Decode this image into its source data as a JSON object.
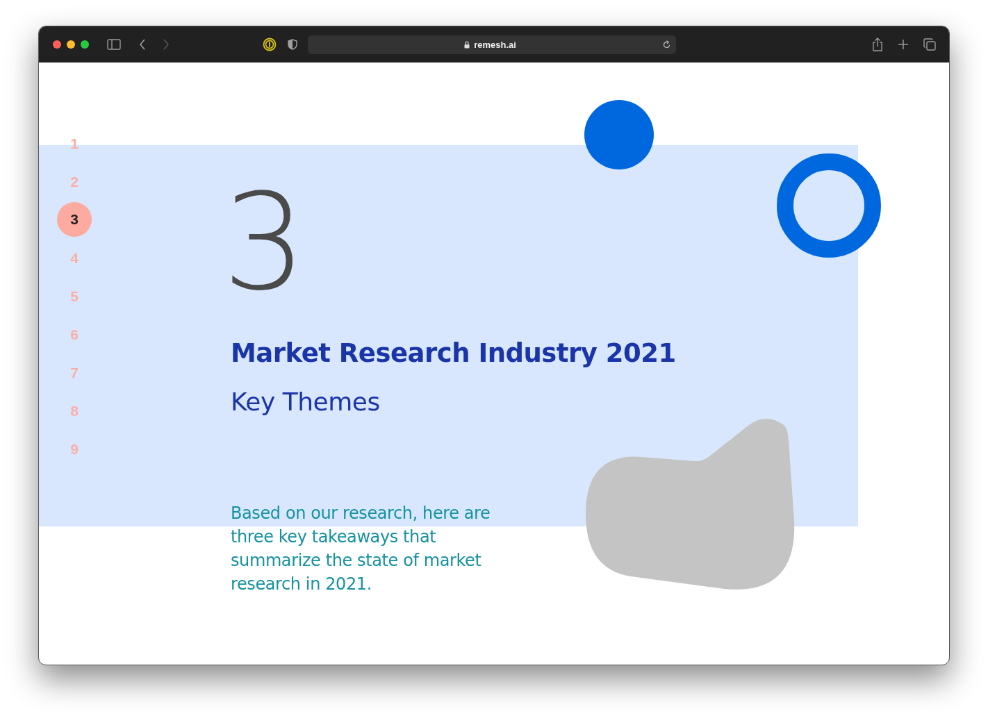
{
  "browser": {
    "url": "remesh.ai"
  },
  "nav": [
    {
      "label": "1",
      "selected": false
    },
    {
      "label": "2",
      "selected": false
    },
    {
      "label": "3",
      "selected": true
    },
    {
      "label": "4",
      "selected": false
    },
    {
      "label": "5",
      "selected": false
    },
    {
      "label": "6",
      "selected": false
    },
    {
      "label": "7",
      "selected": false
    },
    {
      "label": "8",
      "selected": false
    },
    {
      "label": "9",
      "selected": false
    }
  ],
  "section": {
    "number": "3",
    "title": "Market Research Industry 2021",
    "subtitle": "Key Themes",
    "body": "Based on our research, here are three key takeaways that summarize the state of market research in 2021."
  }
}
